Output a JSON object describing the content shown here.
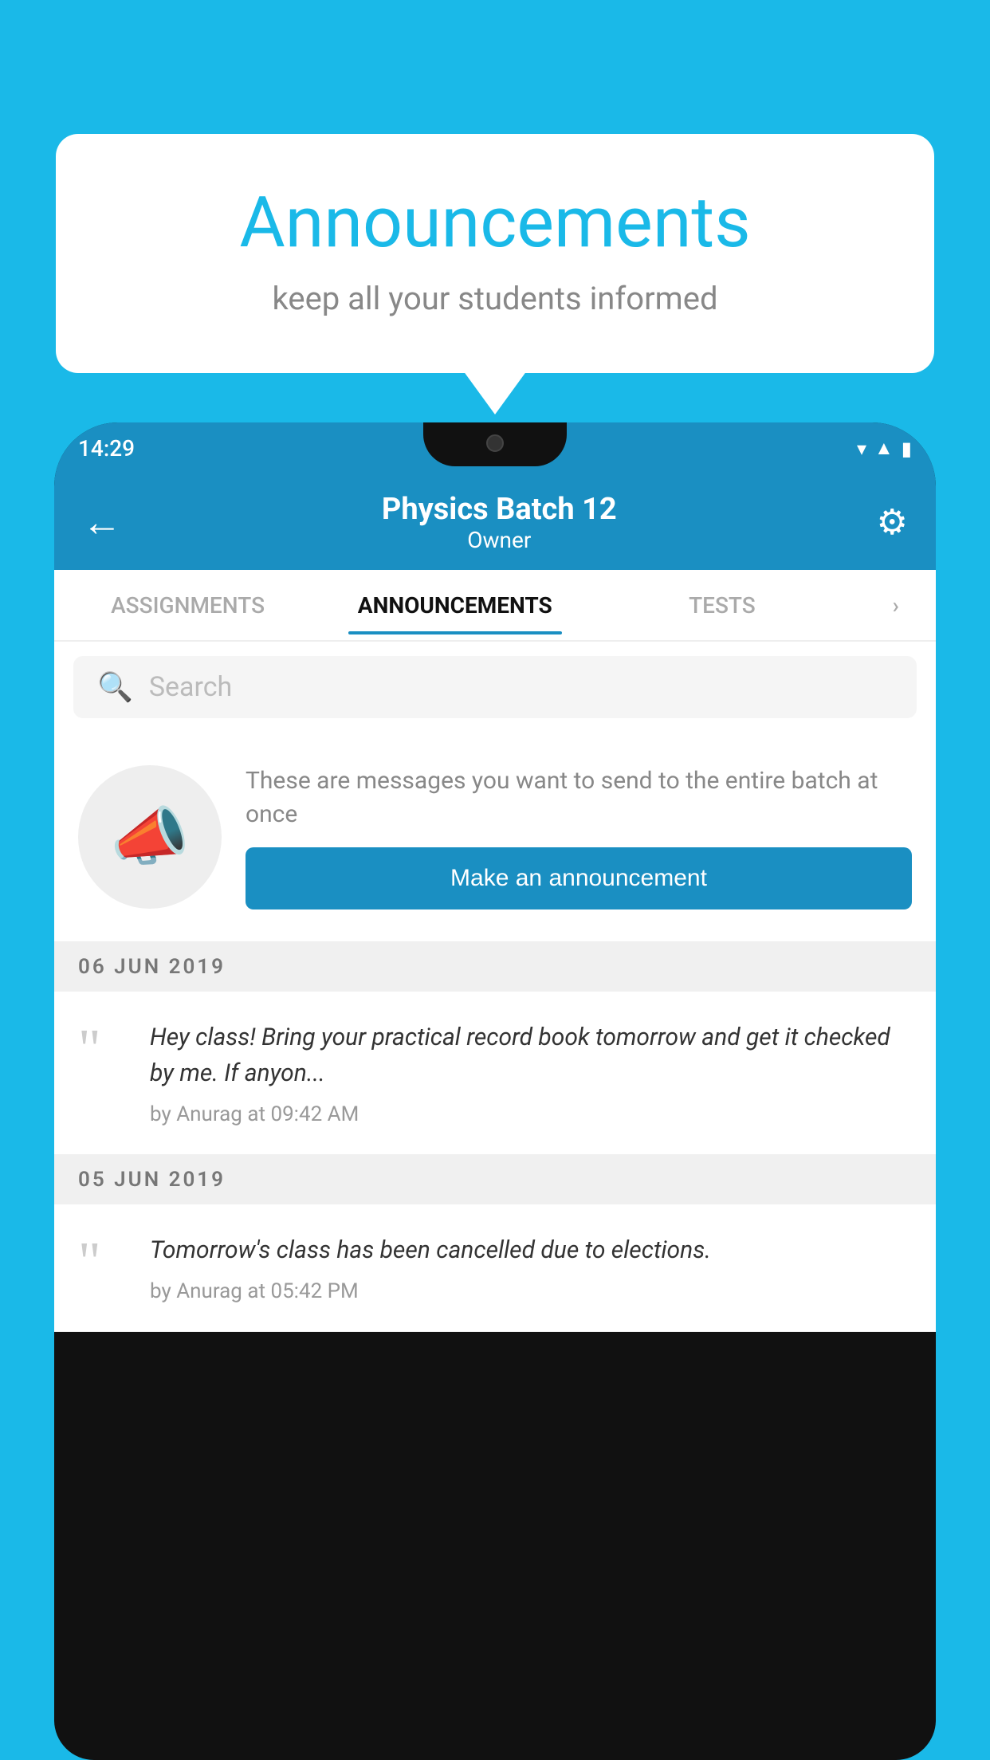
{
  "background": {
    "color": "#1ab9e8"
  },
  "announcement_card": {
    "title": "Announcements",
    "subtitle": "keep all your students informed"
  },
  "phone": {
    "status_bar": {
      "time": "14:29"
    },
    "header": {
      "batch_name": "Physics Batch 12",
      "role": "Owner",
      "back_label": "←",
      "settings_label": "⚙"
    },
    "tabs": [
      {
        "label": "ASSIGNMENTS",
        "active": false
      },
      {
        "label": "ANNOUNCEMENTS",
        "active": true
      },
      {
        "label": "TESTS",
        "active": false
      },
      {
        "label": "...",
        "active": false
      }
    ],
    "search": {
      "placeholder": "Search"
    },
    "cta": {
      "description": "These are messages you want to send to the entire batch at once",
      "button_label": "Make an announcement"
    },
    "announcements": [
      {
        "date": "06  JUN  2019",
        "message": "Hey class! Bring your practical record book tomorrow and get it checked by me. If anyon...",
        "meta": "by Anurag at 09:42 AM"
      },
      {
        "date": "05  JUN  2019",
        "message": "Tomorrow's class has been cancelled due to elections.",
        "meta": "by Anurag at 05:42 PM"
      }
    ]
  }
}
